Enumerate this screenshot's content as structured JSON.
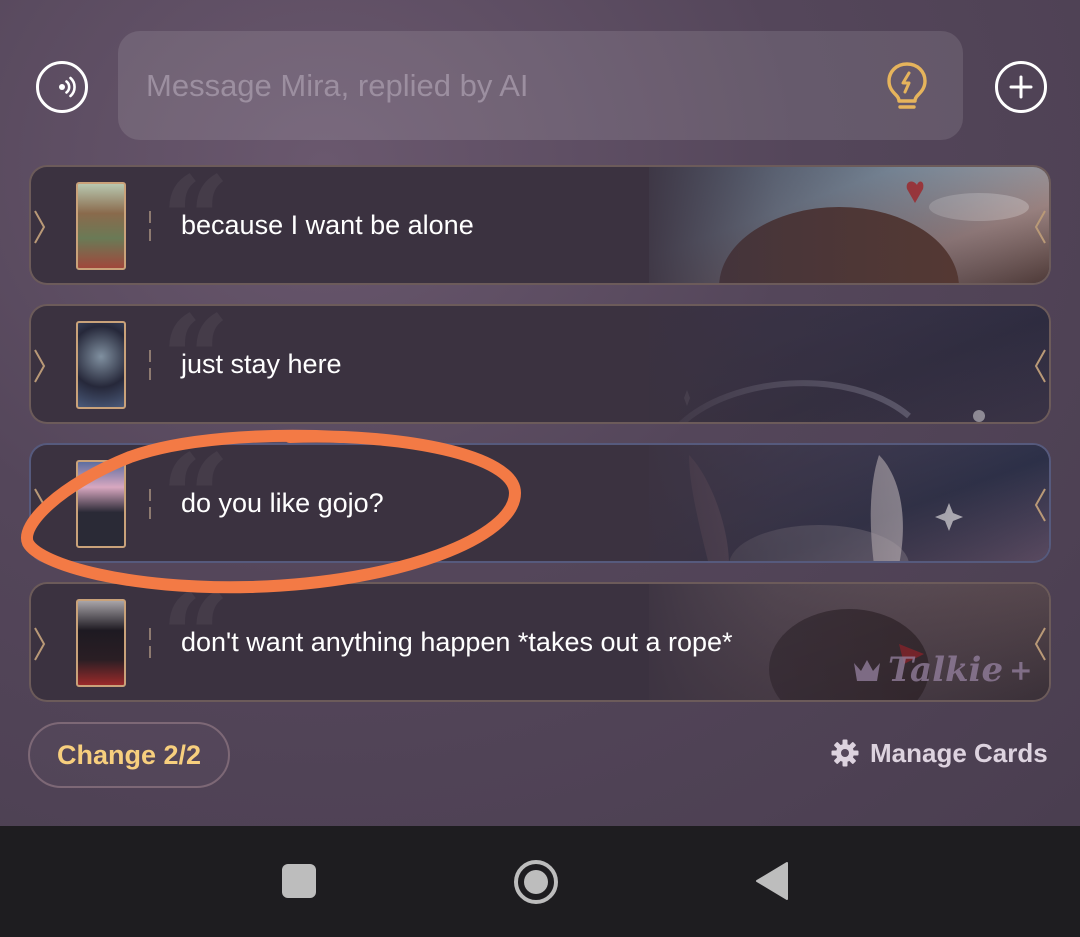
{
  "composer": {
    "placeholder": "Message Mira, replied by AI"
  },
  "icons": {
    "voice": "voice-waves-icon",
    "idea": "lightbulb-icon",
    "add": "plus-circle-icon",
    "settings": "gear-icon"
  },
  "cards": [
    {
      "text": "because I want be alone"
    },
    {
      "text": "just stay here"
    },
    {
      "text": "do you like gojo?"
    },
    {
      "text": "don't want anything happen *takes out a rope*"
    }
  ],
  "watermark": "Talkie",
  "footer": {
    "change_label": "Change 2/2",
    "manage_label": "Manage Cards"
  },
  "colors": {
    "accent_gold": "#f7cf7e",
    "annotation_orange": "#f37a45",
    "panel_bg": "#54465a"
  }
}
